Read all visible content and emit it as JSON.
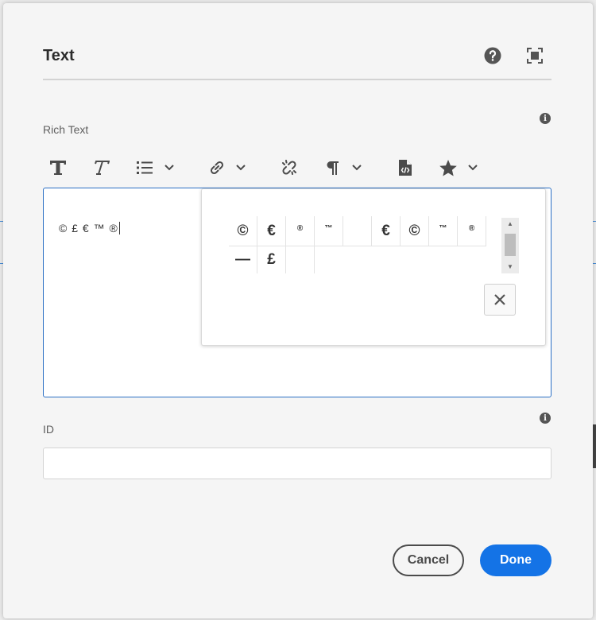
{
  "dialog": {
    "title": "Text",
    "help_icon": "help-circle-icon",
    "fullscreen_icon": "fullscreen-icon"
  },
  "rich_text": {
    "label": "Rich Text",
    "info_icon": "info-icon",
    "info_glyph": "i",
    "toolbar": [
      "bold-icon",
      "italic-icon",
      "list-icon",
      "list-chevron-down-icon",
      "link-icon",
      "link-chevron-down-icon",
      "unlink-icon",
      "paragraph-icon",
      "paragraph-chevron-down-icon",
      "source-edit-icon",
      "star-icon",
      "star-chevron-down-icon"
    ],
    "editor_value": "© £ € ™ ®"
  },
  "special_chars": {
    "row1": [
      "©",
      "€",
      "®",
      "™",
      "",
      "€",
      "©",
      "™",
      "®"
    ],
    "row2": [
      "—",
      "£",
      ""
    ],
    "scroll_up": "▲",
    "scroll_down": "▼",
    "close_icon": "close-icon"
  },
  "id_field": {
    "label": "ID",
    "info_icon": "info-icon",
    "info_glyph": "i",
    "value": ""
  },
  "footer": {
    "cancel_label": "Cancel",
    "done_label": "Done"
  },
  "colors": {
    "accent": "#1473e6",
    "editor_border": "#2b6fc4",
    "icon": "#4b4b4b"
  }
}
